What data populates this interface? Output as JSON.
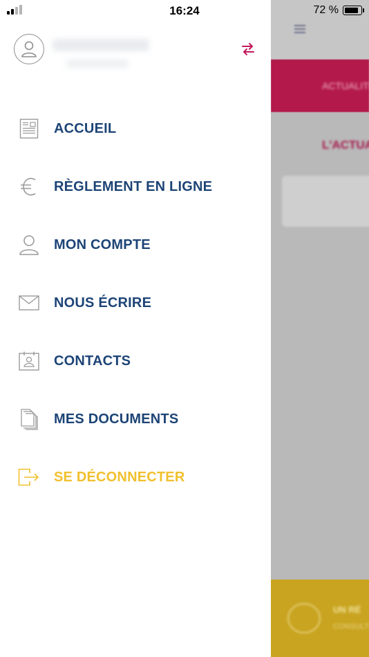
{
  "status_bar": {
    "time": "16:24",
    "battery_percent": "72 %",
    "battery_level": 0.72,
    "signal_bars": 2
  },
  "drawer": {
    "switch_icon": "swap-arrows-icon",
    "accent_color": "#c2185b",
    "menu": [
      {
        "label": "ACCUEIL",
        "icon": "newspaper-icon"
      },
      {
        "label": "RÈGLEMENT EN LIGNE",
        "icon": "euro-icon"
      },
      {
        "label": "MON COMPTE",
        "icon": "user-icon"
      },
      {
        "label": "NOUS ÉCRIRE",
        "icon": "envelope-icon"
      },
      {
        "label": "CONTACTS",
        "icon": "contact-card-icon"
      },
      {
        "label": "MES DOCUMENTS",
        "icon": "documents-icon"
      }
    ],
    "logout": {
      "label": "SE DÉCONNECTER",
      "icon": "logout-icon"
    },
    "colors": {
      "menu_text": "#1d4476",
      "logout_text": "#f1c02e",
      "icon_gray": "#9a9a9a"
    }
  },
  "background_app": {
    "tab_label": "ACTUALITÉS",
    "section_title": "L'ACTUALITÉ",
    "banner_title": "UN RÉ",
    "banner_subtitle": "CONSULTER"
  }
}
